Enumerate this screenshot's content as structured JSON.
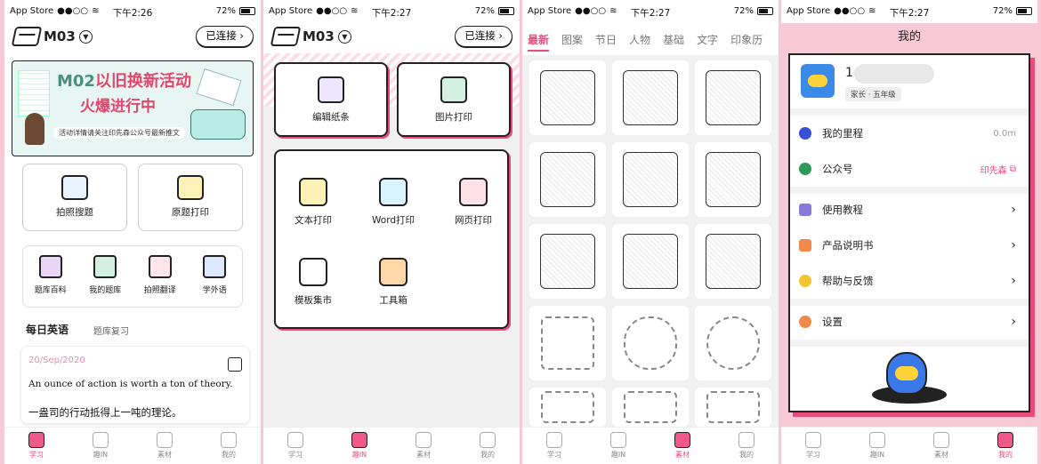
{
  "status": {
    "carrier": "App Store",
    "battery": "72%"
  },
  "screens": [
    {
      "time": "下午2:26"
    },
    {
      "time": "下午2:27"
    },
    {
      "time": "下午2:27"
    },
    {
      "time": "下午2:27"
    }
  ],
  "header": {
    "device": "M03",
    "connected": "已连接"
  },
  "banner": {
    "line1_a": "M02",
    "line1_b": "以旧换新活动",
    "line2": "火爆进行中",
    "line3": "活动详情请关注印先森公众号最新推文"
  },
  "home": {
    "features": [
      {
        "label": "拍照搜题",
        "icon": "photo-search-icon"
      },
      {
        "label": "原题打印",
        "icon": "printer-icon"
      }
    ],
    "tools": [
      {
        "label": "题库百科",
        "icon": "books-icon"
      },
      {
        "label": "我的题库",
        "icon": "question-bank-icon"
      },
      {
        "label": "拍照翻译",
        "icon": "translate-icon"
      },
      {
        "label": "学外语",
        "icon": "language-book-icon"
      }
    ],
    "english_title": "每日英语",
    "review_label": "题库复习",
    "date": "20/Sep/2020",
    "sentence_en": "An ounce of action is worth a ton of theory.",
    "sentence_cn": "一盎司的行动抵得上一吨的理论。"
  },
  "fun": {
    "top": [
      {
        "label": "编辑纸条",
        "icon": "edit-note-icon"
      },
      {
        "label": "图片打印",
        "icon": "image-icon"
      }
    ],
    "items": [
      {
        "label": "文本打印",
        "icon": "text-icon"
      },
      {
        "label": "Word打印",
        "icon": "word-icon"
      },
      {
        "label": "网页打印",
        "icon": "monitor-icon"
      },
      {
        "label": "模板集市",
        "icon": "template-icon"
      },
      {
        "label": "工具箱",
        "icon": "toolbox-icon"
      }
    ]
  },
  "material": {
    "categories": [
      "最新",
      "图案",
      "节日",
      "人物",
      "基础",
      "文字",
      "印象历"
    ],
    "items": [
      "polaroid-camera",
      "lantern",
      "umbrella-flowers",
      "crown",
      "camera",
      "coffee-grinder",
      "sewing-machine",
      "telephone",
      "hourglass",
      "frame-rect",
      "frame-crown",
      "frame-oval",
      "frame-ornate-1",
      "frame-ornate-2",
      "frame-ornate-3"
    ]
  },
  "profile": {
    "title": "我的",
    "username": "1",
    "role": "家长 · 五年级",
    "rows": [
      {
        "label": "我的里程",
        "value": "0.0m",
        "icon": "mileage-icon",
        "color": "#3a4fd8"
      },
      {
        "label": "公众号",
        "value": "印先森",
        "icon": "wechat-account-icon",
        "color": "#2e9a5a"
      },
      {
        "label": "使用教程",
        "value": "",
        "icon": "tutorial-icon",
        "color": "#8a7ad8"
      },
      {
        "label": "产品说明书",
        "value": "",
        "icon": "manual-icon",
        "color": "#f08a4a"
      },
      {
        "label": "帮助与反馈",
        "value": "",
        "icon": "help-icon",
        "color": "#f2c431"
      },
      {
        "label": "设置",
        "value": "",
        "icon": "settings-gear-icon",
        "color": "#f08a4a"
      }
    ]
  },
  "tabs": [
    "学习",
    "趣IN",
    "素材",
    "我的"
  ],
  "colors": {
    "accent": "#e94b7a",
    "background": "#f7c9d7"
  }
}
